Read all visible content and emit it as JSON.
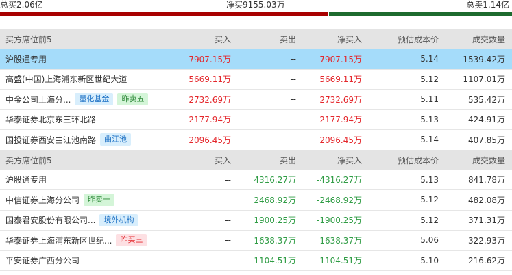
{
  "summary": {
    "total_buy": "总买2.06亿",
    "net_buy": "净买9155.03万",
    "total_sell": "总卖1.14亿"
  },
  "colors": {
    "buy_bar": "#a80000",
    "sell_bar": "#1d6b2e",
    "up": "#e4262b",
    "down": "#2f9c44",
    "highlight": "#a5dcfa"
  },
  "buy_section": {
    "headers": {
      "name": "买方席位前5",
      "buy": "买入",
      "sell": "卖出",
      "net": "净买入",
      "cost": "预估成本价",
      "volume": "成交数量"
    },
    "rows": [
      {
        "name": "沪股通专用",
        "tags": [],
        "buy": "7907.15万",
        "sell": "--",
        "net": "7907.15万",
        "cost": "5.14",
        "volume": "1539.42万"
      },
      {
        "name": "高盛(中国)上海浦东新区世纪大道",
        "tags": [],
        "buy": "5669.11万",
        "sell": "--",
        "net": "5669.11万",
        "cost": "5.12",
        "volume": "1107.01万"
      },
      {
        "name": "中金公司上海分...",
        "tags": [
          {
            "text": "量化基金",
            "style": "blue"
          },
          {
            "text": "昨卖五",
            "style": "green"
          }
        ],
        "buy": "2732.69万",
        "sell": "--",
        "net": "2732.69万",
        "cost": "5.11",
        "volume": "535.42万"
      },
      {
        "name": "华泰证券北京东三环北路",
        "tags": [],
        "buy": "2177.94万",
        "sell": "--",
        "net": "2177.94万",
        "cost": "5.13",
        "volume": "424.91万"
      },
      {
        "name": "国投证券西安曲江池南路",
        "tags": [
          {
            "text": "曲江池",
            "style": "blue"
          }
        ],
        "buy": "2096.45万",
        "sell": "--",
        "net": "2096.45万",
        "cost": "5.14",
        "volume": "407.85万"
      }
    ]
  },
  "sell_section": {
    "headers": {
      "name": "卖方席位前5",
      "buy": "买入",
      "sell": "卖出",
      "net": "净买入",
      "cost": "预估成本价",
      "volume": "成交数量"
    },
    "rows": [
      {
        "name": "沪股通专用",
        "tags": [],
        "buy": "--",
        "sell": "4316.27万",
        "net": "-4316.27万",
        "cost": "5.13",
        "volume": "841.78万"
      },
      {
        "name": "中信证券上海分公司",
        "tags": [
          {
            "text": "昨卖一",
            "style": "green"
          }
        ],
        "buy": "--",
        "sell": "2468.92万",
        "net": "-2468.92万",
        "cost": "5.12",
        "volume": "482.08万"
      },
      {
        "name": "国泰君安股份有限公司...",
        "tags": [
          {
            "text": "境外机构",
            "style": "blue"
          }
        ],
        "buy": "--",
        "sell": "1900.25万",
        "net": "-1900.25万",
        "cost": "5.12",
        "volume": "371.31万"
      },
      {
        "name": "华泰证券上海浦东新区世纪...",
        "tags": [
          {
            "text": "昨买三",
            "style": "pink"
          }
        ],
        "buy": "--",
        "sell": "1638.37万",
        "net": "-1638.37万",
        "cost": "5.06",
        "volume": "322.93万"
      },
      {
        "name": "平安证券广西分公司",
        "tags": [],
        "buy": "--",
        "sell": "1104.51万",
        "net": "-1104.51万",
        "cost": "5.10",
        "volume": "216.62万"
      }
    ]
  }
}
